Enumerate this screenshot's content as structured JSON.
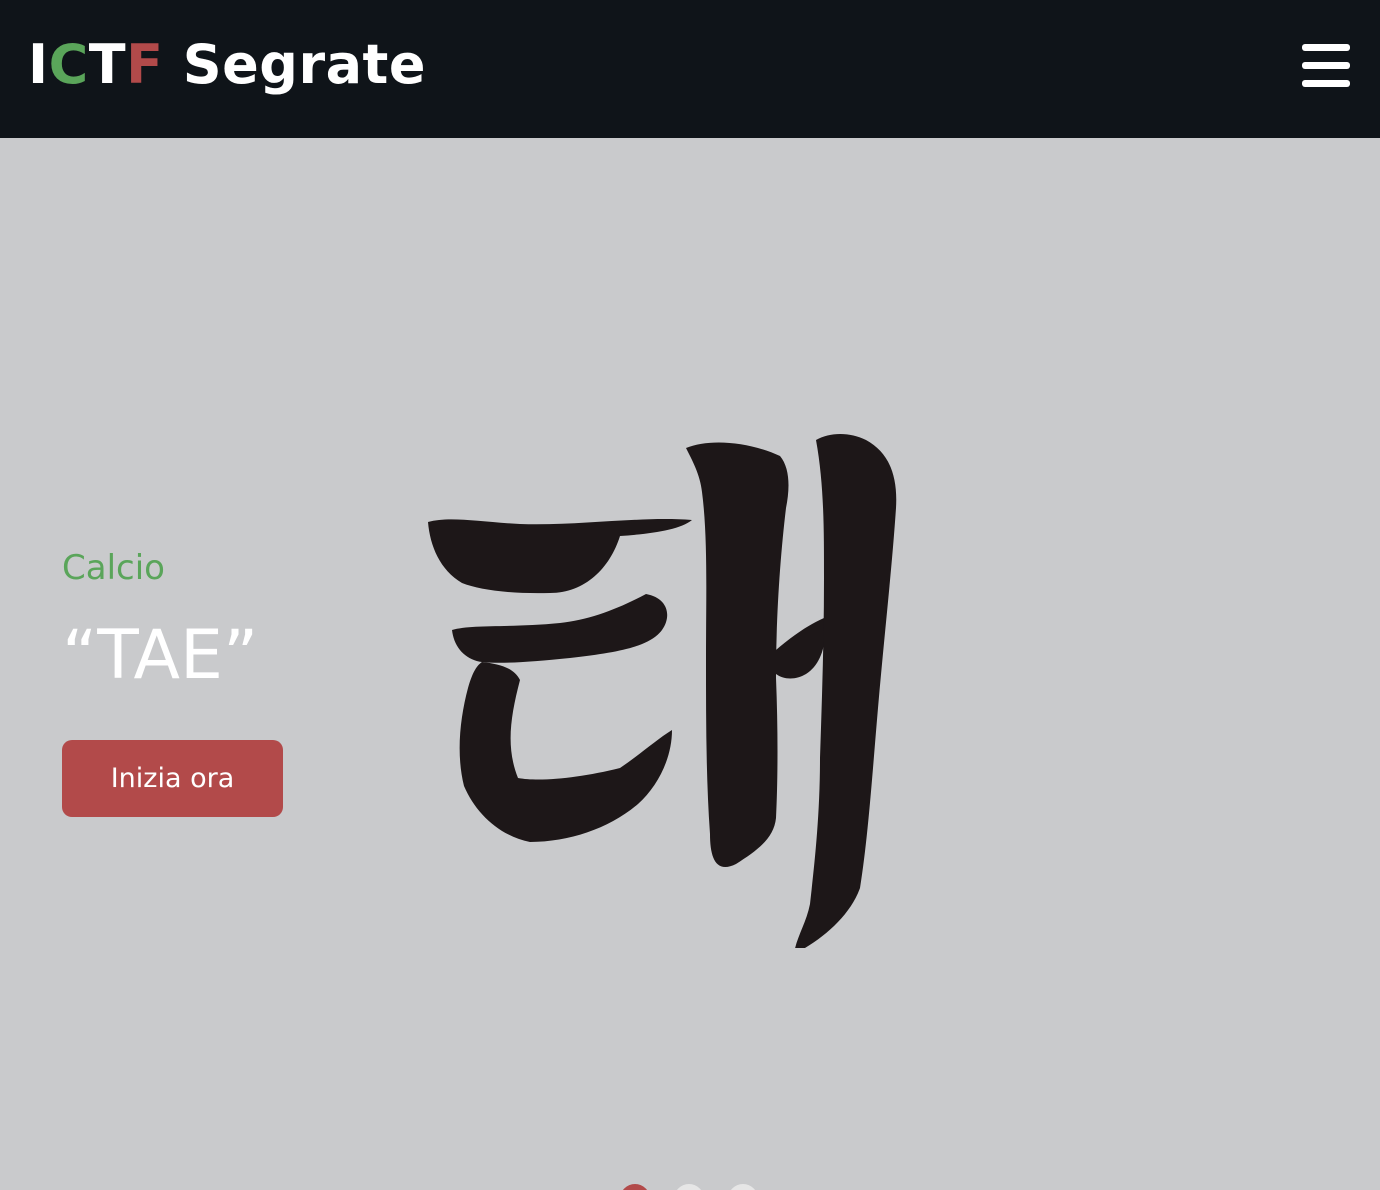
{
  "navbar": {
    "brand": {
      "letter_1": "I",
      "letter_2": "C",
      "letter_3": "T",
      "letter_4": "F",
      "rest": " Segrate"
    },
    "menu_icon": "hamburger-menu-icon"
  },
  "hero": {
    "kicker": "Calcio",
    "title": "“TAE”",
    "cta_label": "Inizia ora",
    "image": "korean-calligraphy-tae-character",
    "slide_indicators": {
      "count": 3,
      "active_index": 0
    }
  },
  "colors": {
    "navbar_bg": "#0f1419",
    "hero_bg": "#c9cacc",
    "accent_green": "#5aa55a",
    "accent_red": "#b24a4a",
    "text_light": "#ffffff"
  }
}
